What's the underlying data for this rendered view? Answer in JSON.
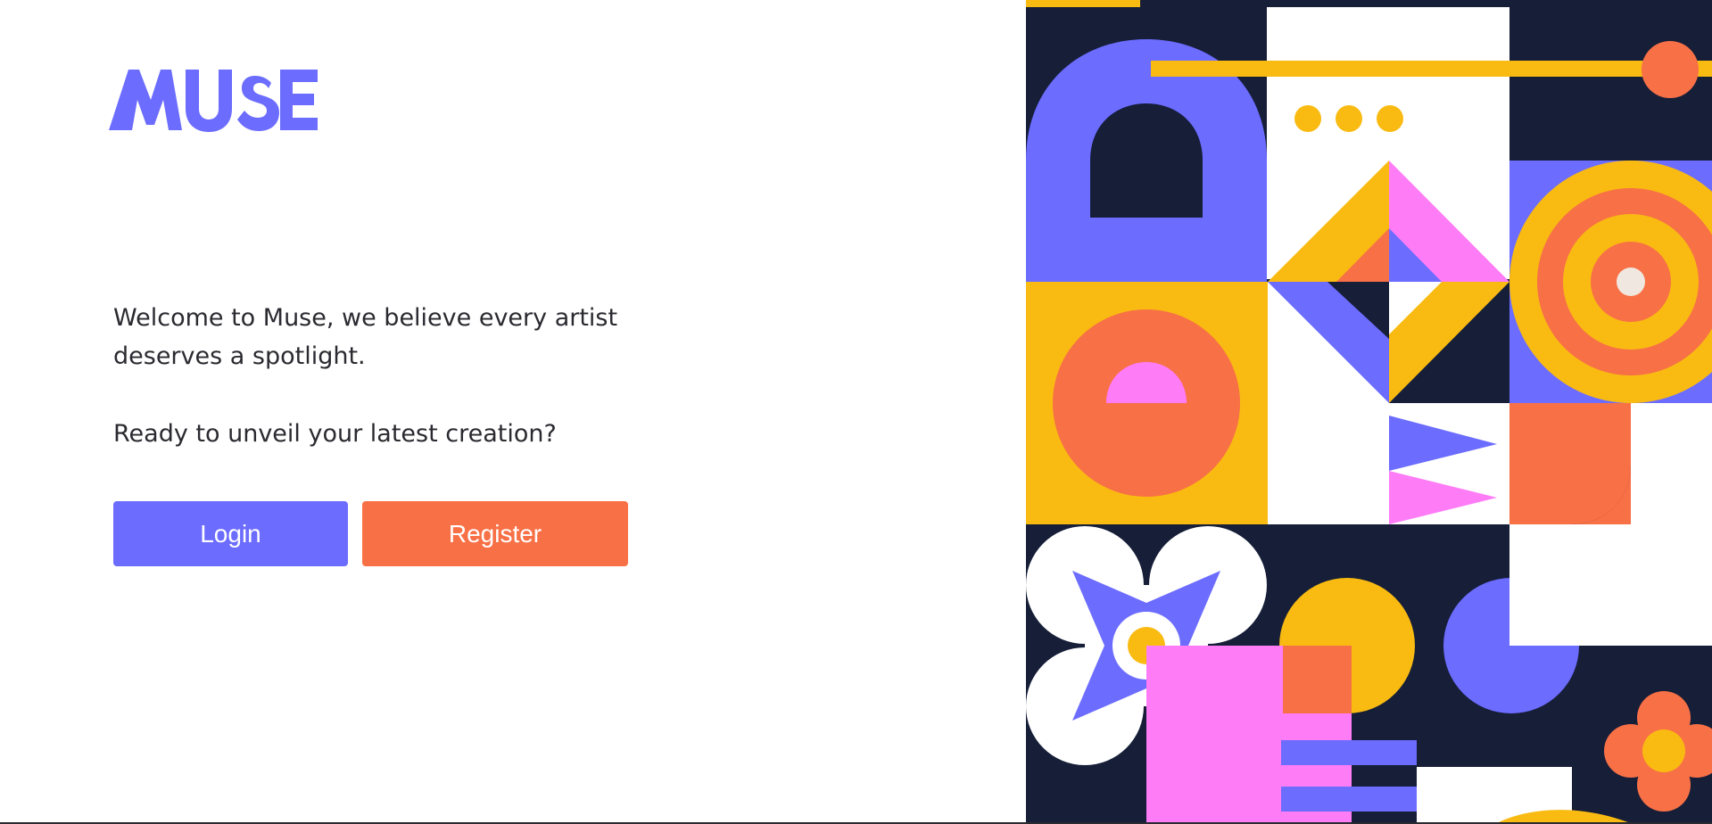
{
  "brand": {
    "logo_text": "MUSE",
    "logo_color": "#6c6cff"
  },
  "intro": {
    "welcome_text": "Welcome to Muse, we believe every artist deserves a spotlight.",
    "prompt_text": "Ready to unveil your latest creation?"
  },
  "actions": {
    "login_label": "Login",
    "register_label": "Register",
    "login_color": "#6c6cff",
    "register_color": "#f87046"
  },
  "palette": {
    "navy": "#161e38",
    "purple": "#6c6cff",
    "yellow": "#f9bb12",
    "orange": "#f87046",
    "pink": "#ff7cf7",
    "white": "#ffffff"
  }
}
